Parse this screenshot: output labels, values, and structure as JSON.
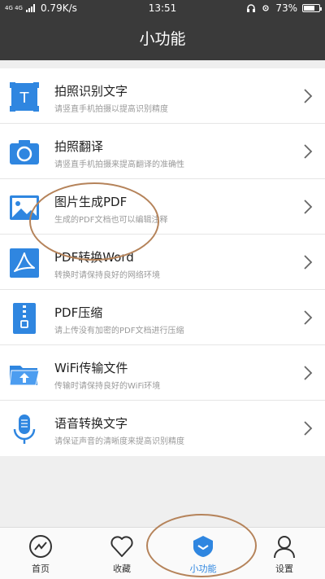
{
  "status_bar": {
    "network_tag": "4G 4G",
    "speed": "0.79K/s",
    "time": "13:51",
    "battery": "73%",
    "battery_level": 0.73
  },
  "header": {
    "title": "小功能"
  },
  "features": [
    {
      "title": "拍照识别文字",
      "subtitle": "请竖直手机拍摄以提高识别精度",
      "icon": "text-recognition-icon"
    },
    {
      "title": "拍照翻译",
      "subtitle": "请竖直手机拍摄来提高翻译的准确性",
      "icon": "camera-icon"
    },
    {
      "title": "图片生成PDF",
      "subtitle": "生成的PDF文档也可以编辑注释",
      "icon": "image-icon"
    },
    {
      "title": "PDF转换Word",
      "subtitle": "转换时请保持良好的网络环境",
      "icon": "pdf-icon"
    },
    {
      "title": "PDF压缩",
      "subtitle": "请上传没有加密的PDF文档进行压缩",
      "icon": "zip-icon"
    },
    {
      "title": "WiFi传输文件",
      "subtitle": "传输时请保持良好的WiFi环境",
      "icon": "folder-upload-icon"
    },
    {
      "title": "语音转换文字",
      "subtitle": "请保证声音的清晰度来提高识别精度",
      "icon": "microphone-icon"
    }
  ],
  "tabs": [
    {
      "label": "首页",
      "icon": "home-icon"
    },
    {
      "label": "收藏",
      "icon": "heart-icon"
    },
    {
      "label": "小功能",
      "icon": "shield-icon",
      "active": true
    },
    {
      "label": "设置",
      "icon": "user-icon"
    }
  ],
  "colors": {
    "accent": "#2f86e0",
    "header_bg": "#3a3a3a",
    "annotation": "#b5835a"
  }
}
